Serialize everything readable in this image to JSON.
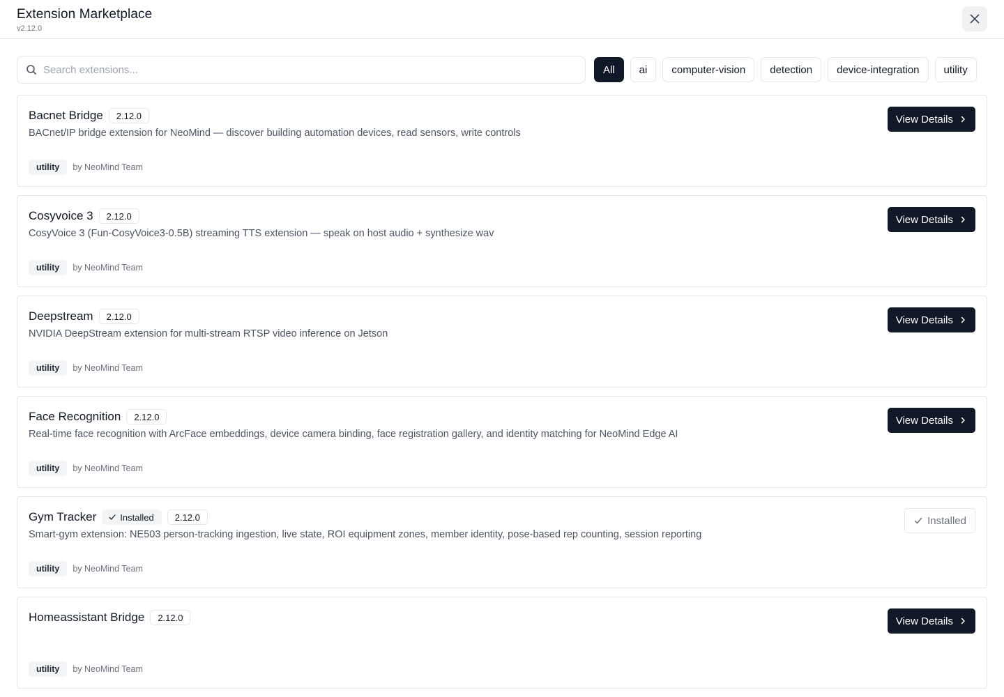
{
  "header": {
    "title": "Extension Marketplace",
    "version": "v2.12.0"
  },
  "search": {
    "placeholder": "Search extensions...",
    "value": ""
  },
  "filters": [
    "All",
    "ai",
    "computer-vision",
    "detection",
    "device-integration",
    "utility"
  ],
  "active_filter": "All",
  "labels": {
    "view_details": "View Details",
    "installed": "Installed"
  },
  "extensions": [
    {
      "name": "Bacnet Bridge",
      "version": "2.12.0",
      "description": "BACnet/IP bridge extension for NeoMind — discover building automation devices, read sensors, write controls",
      "tag": "utility",
      "author": "by NeoMind Team",
      "installed": false
    },
    {
      "name": "Cosyvoice 3",
      "version": "2.12.0",
      "description": "CosyVoice 3 (Fun-CosyVoice3-0.5B) streaming TTS extension — speak on host audio + synthesize wav",
      "tag": "utility",
      "author": "by NeoMind Team",
      "installed": false
    },
    {
      "name": "Deepstream",
      "version": "2.12.0",
      "description": "NVIDIA DeepStream extension for multi-stream RTSP video inference on Jetson",
      "tag": "utility",
      "author": "by NeoMind Team",
      "installed": false
    },
    {
      "name": "Face Recognition",
      "version": "2.12.0",
      "description": "Real-time face recognition with ArcFace embeddings, device camera binding, face registration gallery, and identity matching for NeoMind Edge AI",
      "tag": "utility",
      "author": "by NeoMind Team",
      "installed": false
    },
    {
      "name": "Gym Tracker",
      "version": "2.12.0",
      "description": "Smart-gym extension: NE503 person-tracking ingestion, live state, ROI equipment zones, member identity, pose-based rep counting, session reporting",
      "tag": "utility",
      "author": "by NeoMind Team",
      "installed": true
    },
    {
      "name": "Homeassistant Bridge",
      "version": "2.12.0",
      "description": "",
      "tag": "utility",
      "author": "by NeoMind Team",
      "installed": false
    }
  ]
}
